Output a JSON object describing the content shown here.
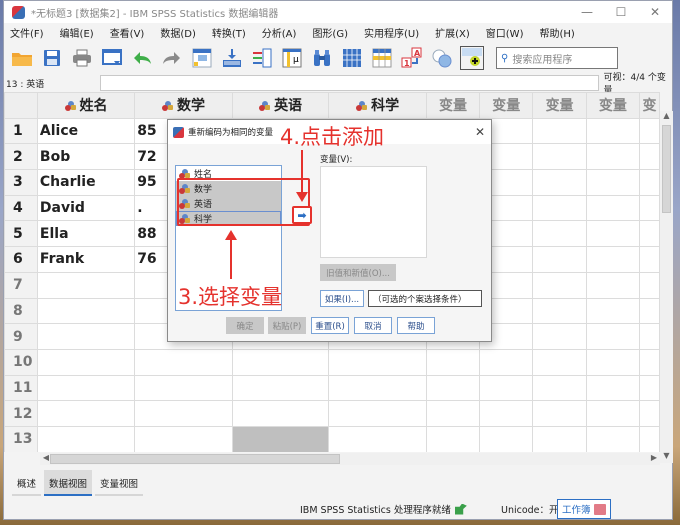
{
  "window": {
    "title": "*无标题3 [数据集2] - IBM SPSS Statistics 数据编辑器",
    "controls": {
      "minimize": "—",
      "maximize": "☐",
      "close": "✕"
    }
  },
  "menu": [
    "文件(F)",
    "编辑(E)",
    "查看(V)",
    "数据(D)",
    "转换(T)",
    "分析(A)",
    "图形(G)",
    "实用程序(U)",
    "扩展(X)",
    "窗口(W)",
    "帮助(H)"
  ],
  "toolbar": {
    "icons": [
      "open-folder-icon",
      "save-icon",
      "print-icon",
      "dialog-recall-icon",
      "undo-icon",
      "redo-icon",
      "goto-case-icon",
      "goto-variable-icon",
      "variables-icon",
      "run-descriptives-icon",
      "find-icon",
      "insert-cases-icon",
      "split-file-icon",
      "value-labels-icon",
      "use-sets-icon",
      "show-all-variables-icon"
    ],
    "search_placeholder": "搜索应用程序"
  },
  "cellbar": {
    "cell_ref": "13 : 英语",
    "value": "",
    "visible": "可视：4/4 个变量"
  },
  "grid": {
    "columns": [
      "姓名",
      "数学",
      "英语",
      "科学",
      "变量",
      "变量",
      "变量",
      "变量",
      "变"
    ],
    "rows": [
      {
        "n": "1",
        "cells": [
          "Alice",
          "85",
          "",
          ""
        ]
      },
      {
        "n": "2",
        "cells": [
          "Bob",
          "72",
          "",
          ""
        ]
      },
      {
        "n": "3",
        "cells": [
          "Charlie",
          "95",
          "",
          ""
        ]
      },
      {
        "n": "4",
        "cells": [
          "David",
          ".",
          "",
          ""
        ]
      },
      {
        "n": "5",
        "cells": [
          "Ella",
          "88",
          "",
          ""
        ]
      },
      {
        "n": "6",
        "cells": [
          "Frank",
          "76",
          "",
          ""
        ]
      },
      {
        "n": "7",
        "cells": [
          "",
          "",
          "",
          ""
        ]
      },
      {
        "n": "8",
        "cells": [
          "",
          "",
          "",
          ""
        ]
      },
      {
        "n": "9",
        "cells": [
          "",
          "",
          "",
          ""
        ]
      },
      {
        "n": "10",
        "cells": [
          "",
          "",
          "",
          ""
        ]
      },
      {
        "n": "11",
        "cells": [
          "",
          "",
          "",
          ""
        ]
      },
      {
        "n": "12",
        "cells": [
          "",
          "",
          "",
          ""
        ]
      },
      {
        "n": "13",
        "cells": [
          "",
          "",
          "",
          ""
        ]
      }
    ],
    "selected_cell": {
      "row": "13",
      "column": "英语"
    }
  },
  "tabs": [
    {
      "label": "概述",
      "active": false
    },
    {
      "label": "数据视图",
      "active": true
    },
    {
      "label": "变量视图",
      "active": false
    }
  ],
  "status": {
    "processor": "IBM SPSS Statistics 处理程序就绪",
    "unicode": "Unicode：开",
    "workbook": "工作簿"
  },
  "dialog": {
    "title": "重新编码为相同的变量",
    "source_items": [
      {
        "label": "姓名",
        "selected": false
      },
      {
        "label": "数学",
        "selected": true
      },
      {
        "label": "英语",
        "selected": true
      },
      {
        "label": "科学",
        "selected": true
      }
    ],
    "target_label": "变量(V):",
    "old_new_button": "旧值和新值(O)...",
    "if_button": "如果(I)...",
    "condition_text": "（可选的个案选择条件）",
    "buttons": {
      "ok": "确定",
      "paste": "粘贴(P)",
      "reset": "重置(R)",
      "cancel": "取消",
      "help": "帮助"
    },
    "close": "✕"
  },
  "annotations": {
    "step3": "3.选择变量",
    "step4": "4.点击添加",
    "color": "#e5322d"
  }
}
